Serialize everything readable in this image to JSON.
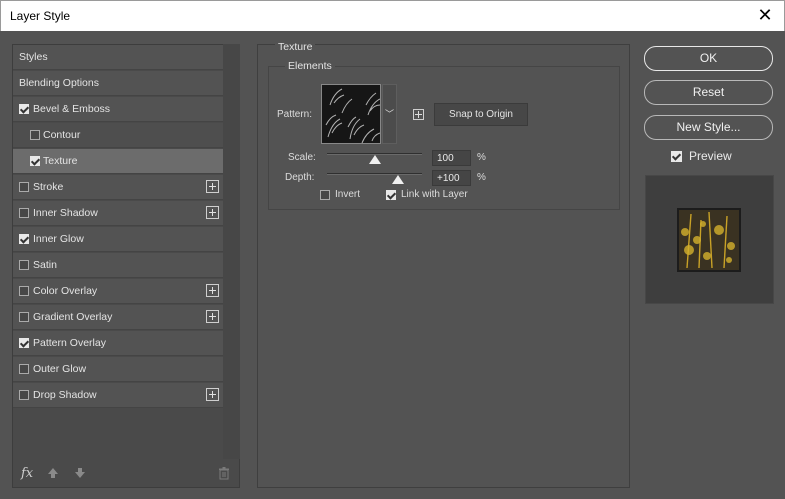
{
  "window": {
    "title": "Layer Style",
    "close_glyph": "✕"
  },
  "styles_list": [
    {
      "label": "Styles",
      "checkbox": false,
      "checked": false,
      "plus": false,
      "sub": false,
      "selected": false
    },
    {
      "label": "Blending Options",
      "checkbox": false,
      "checked": false,
      "plus": false,
      "sub": false,
      "selected": false
    },
    {
      "label": "Bevel & Emboss",
      "checkbox": true,
      "checked": true,
      "plus": false,
      "sub": false,
      "selected": false
    },
    {
      "label": "Contour",
      "checkbox": true,
      "checked": false,
      "plus": false,
      "sub": true,
      "selected": false
    },
    {
      "label": "Texture",
      "checkbox": true,
      "checked": true,
      "plus": false,
      "sub": true,
      "selected": true
    },
    {
      "label": "Stroke",
      "checkbox": true,
      "checked": false,
      "plus": true,
      "sub": false,
      "selected": false
    },
    {
      "label": "Inner Shadow",
      "checkbox": true,
      "checked": false,
      "plus": true,
      "sub": false,
      "selected": false
    },
    {
      "label": "Inner Glow",
      "checkbox": true,
      "checked": true,
      "plus": false,
      "sub": false,
      "selected": false
    },
    {
      "label": "Satin",
      "checkbox": true,
      "checked": false,
      "plus": false,
      "sub": false,
      "selected": false
    },
    {
      "label": "Color Overlay",
      "checkbox": true,
      "checked": false,
      "plus": true,
      "sub": false,
      "selected": false
    },
    {
      "label": "Gradient Overlay",
      "checkbox": true,
      "checked": false,
      "plus": true,
      "sub": false,
      "selected": false
    },
    {
      "label": "Pattern Overlay",
      "checkbox": true,
      "checked": true,
      "plus": false,
      "sub": false,
      "selected": false
    },
    {
      "label": "Outer Glow",
      "checkbox": true,
      "checked": false,
      "plus": false,
      "sub": false,
      "selected": false
    },
    {
      "label": "Drop Shadow",
      "checkbox": true,
      "checked": false,
      "plus": true,
      "sub": false,
      "selected": false
    }
  ],
  "footer": {
    "fx_label": "fx",
    "up_icon": "arrow-up-icon",
    "down_icon": "arrow-down-icon",
    "trash_icon": "trash-icon"
  },
  "texture": {
    "section_title": "Texture",
    "group_title": "Elements",
    "pattern_label": "Pattern:",
    "snap_button": "Snap to Origin",
    "scale_label": "Scale:",
    "scale_value": "100",
    "scale_unit": "%",
    "scale_fraction": 0.5,
    "depth_label": "Depth:",
    "depth_value": "+100",
    "depth_unit": "%",
    "depth_fraction": 0.75,
    "invert_label": "Invert",
    "invert_checked": false,
    "link_label": "Link with Layer",
    "link_checked": true
  },
  "buttons": {
    "ok": "OK",
    "reset": "Reset",
    "new_style": "New Style..."
  },
  "preview": {
    "label": "Preview",
    "checked": true
  },
  "colors": {
    "accent_checkbox": "#e8e8e8",
    "selected_row": "#6c6c6c",
    "panel_bg": "#535353"
  }
}
